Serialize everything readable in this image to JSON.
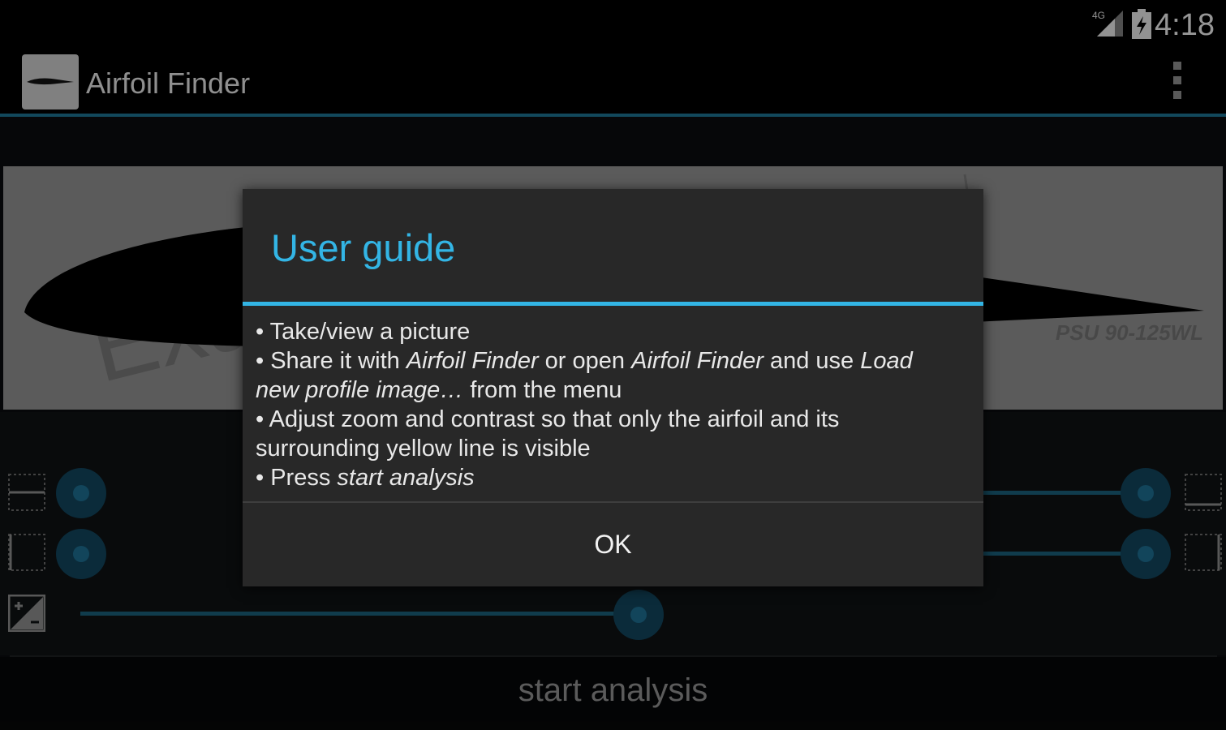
{
  "status_bar": {
    "time": "4:18",
    "network": "4G",
    "signal_icon": "signal-icon",
    "battery_icon": "battery-icon"
  },
  "action_bar": {
    "title": "Airfoil Finder",
    "app_icon": "airfoil-app-icon",
    "menu_icon": "overflow-menu-icon"
  },
  "profile": {
    "watermark": "Exa",
    "label": "PSU 90-125WL"
  },
  "controls": {
    "icons": [
      "horizontal-zoom-icon",
      "vertical-zoom-icon",
      "contrast-icon"
    ],
    "sliders": [
      {
        "name": "horizontal-zoom",
        "left_value": 0.0,
        "right_value": 1.0
      },
      {
        "name": "vertical-zoom",
        "left_value": 0.0,
        "right_value": 1.0
      },
      {
        "name": "contrast",
        "value": 0.51
      }
    ]
  },
  "start_analysis": {
    "label": "start analysis"
  },
  "dialog": {
    "title": "User guide",
    "items": {
      "item1": "• Take/view a picture",
      "item2_prefix": "• Share it with ",
      "item2_app1": "Airfoil Finder",
      "item2_mid": " or open ",
      "item2_app2": "Airfoil Finder",
      "item2_mid2": " and use ",
      "item2_menu": "Load new profile image…",
      "item2_suffix": " from the menu",
      "item3": "• Adjust zoom and contrast so that only the airfoil and its surrounding yellow line is visible",
      "item4_prefix": "• Press ",
      "item4_action": "start analysis"
    },
    "ok_label": "OK"
  },
  "colors": {
    "accent": "#33b5e5",
    "slider_track": "#1a5d77",
    "slider_knob": "#11425a"
  }
}
